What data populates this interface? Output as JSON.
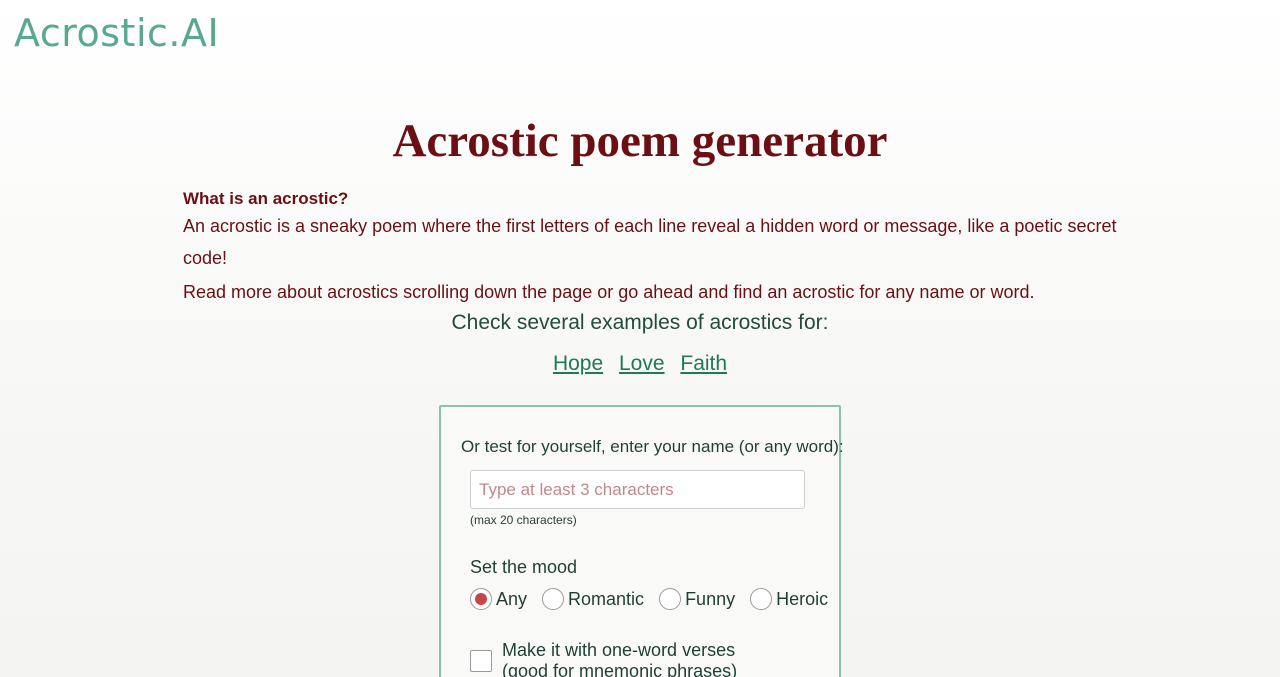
{
  "header": {
    "logo": "Acrostic.AI"
  },
  "page": {
    "title": "Acrostic poem generator"
  },
  "intro": {
    "heading": "What is an acrostic?",
    "p1": "An acrostic is a sneaky poem where the first letters of each line reveal a hidden word or message, like a poetic secret code!",
    "p2": "Read more about acrostics scrolling down the page or go ahead and find an acrostic for any name or word."
  },
  "examples": {
    "title": "Check several examples of acrostics for:",
    "links": [
      "Hope",
      "Love",
      "Faith"
    ]
  },
  "form": {
    "prompt": "Or test for yourself, enter your name (or any word):",
    "input_placeholder": "Type at least 3 characters",
    "input_value": "",
    "max_note": "(max 20 characters)",
    "mood_label": "Set the mood",
    "moods": [
      {
        "label": "Any",
        "checked": true
      },
      {
        "label": "Romantic",
        "checked": false
      },
      {
        "label": "Funny",
        "checked": false
      },
      {
        "label": "Heroic",
        "checked": false
      }
    ],
    "one_word_line1": "Make it with one-word verses",
    "one_word_line2": "(good for mnemonic phrases)",
    "one_word_checked": false
  },
  "colors": {
    "logo": "#5aa892",
    "title": "#6b0f14",
    "link": "#1f7a55",
    "radio_selected": "#c8454b",
    "form_border": "#8cc2b0"
  }
}
